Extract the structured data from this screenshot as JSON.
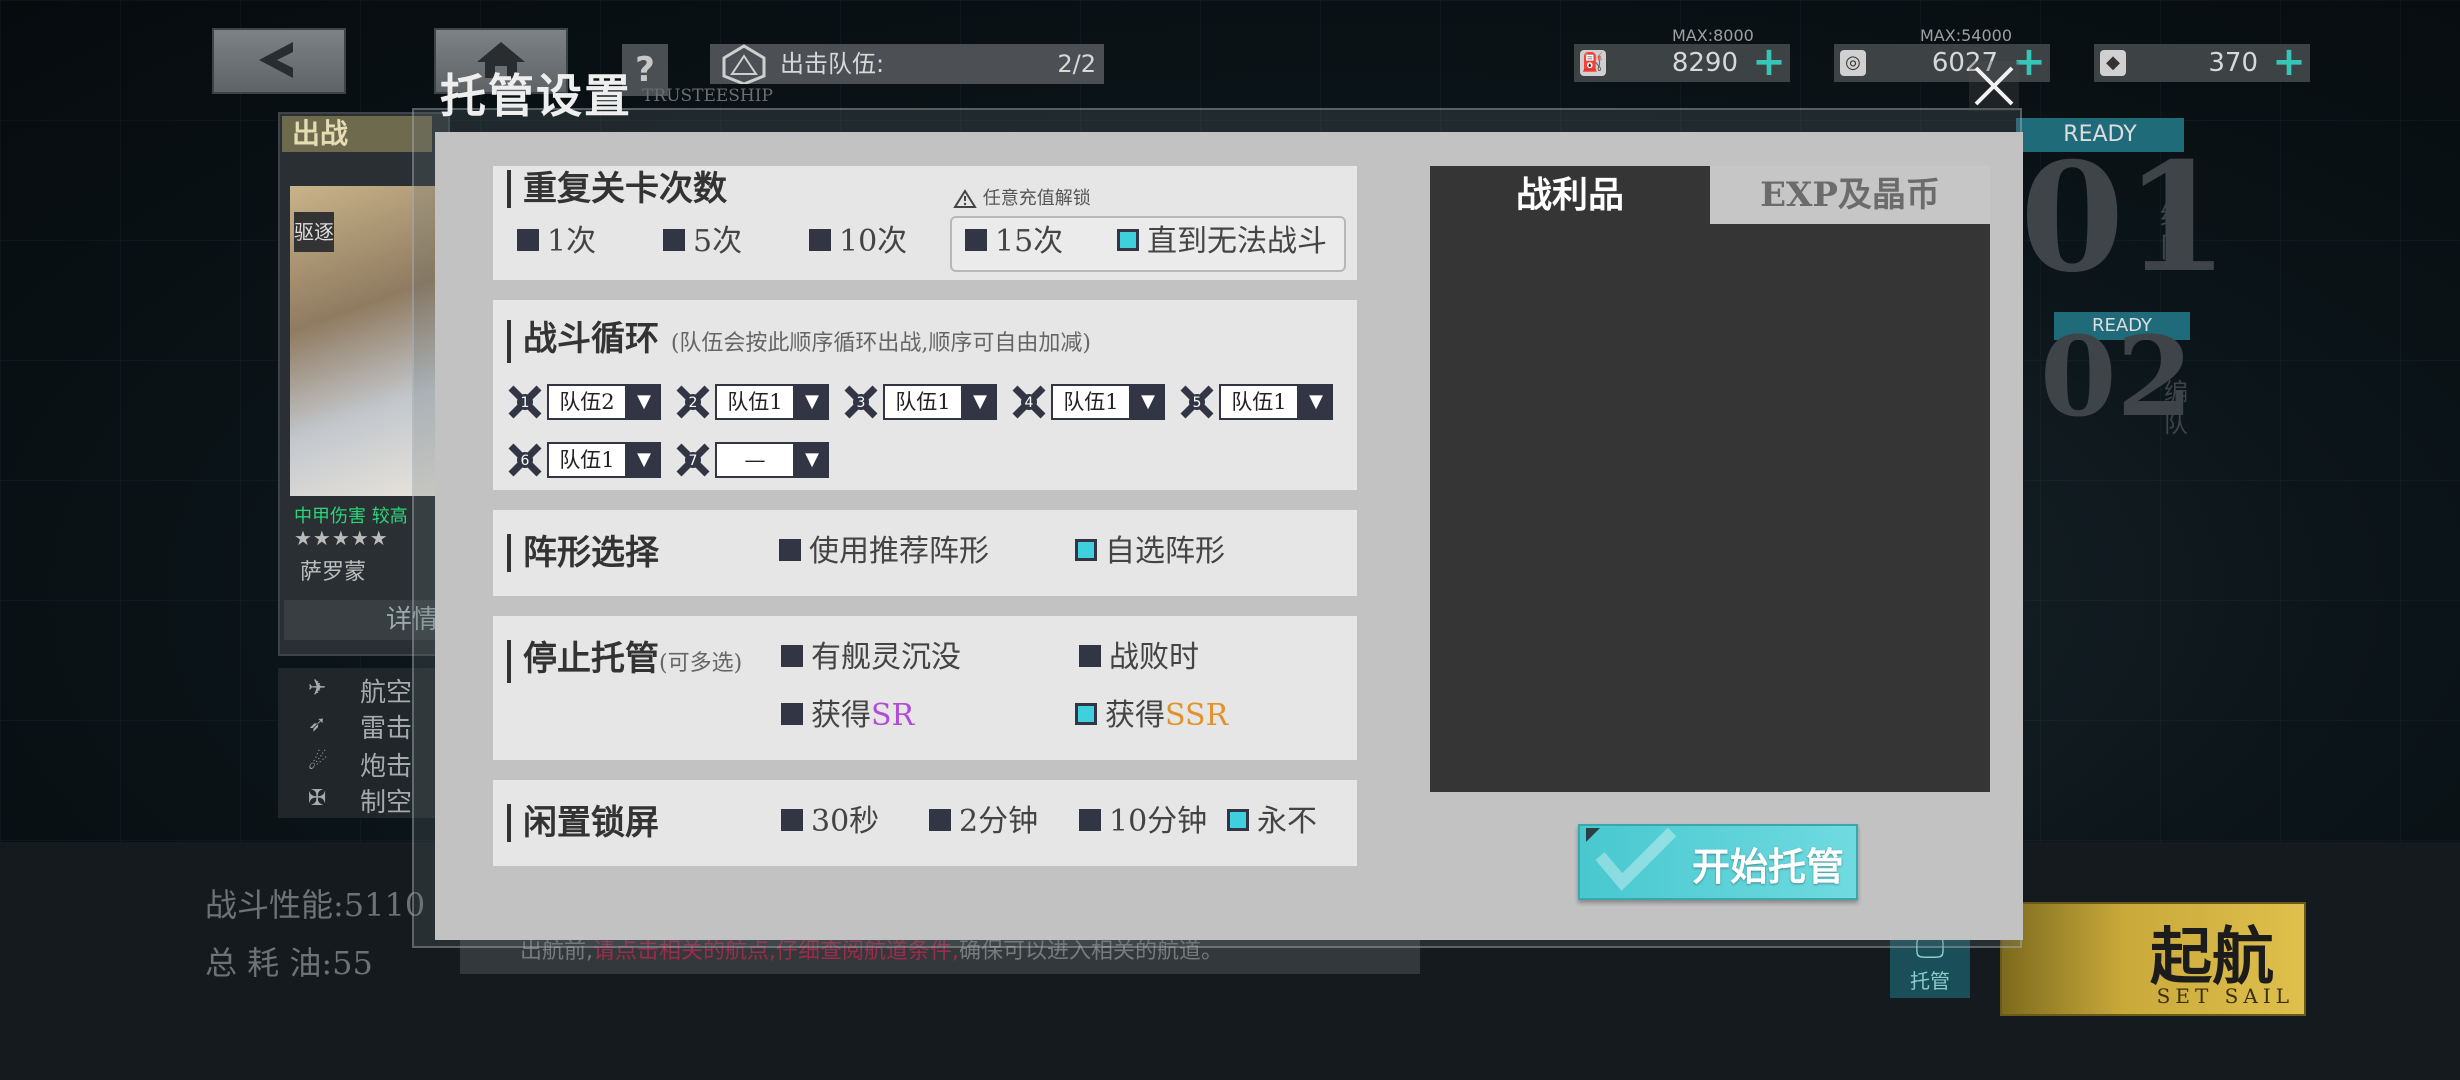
{
  "window": {
    "help": "?",
    "trustee_en": "TRUSTEESHIP"
  },
  "resources": {
    "sortie_label": "出击队伍:",
    "sortie_value": "2/2",
    "fuel": {
      "max": "MAX:8000",
      "value": "8290"
    },
    "coin": {
      "max": "MAX:54000",
      "value": "6027"
    },
    "gem": {
      "value": "370"
    }
  },
  "background": {
    "char_header": "出战",
    "char_type": "驱逐",
    "char_tag": "中甲伤害 较高",
    "char_stars": "★★★★★",
    "char_name": "萨罗蒙",
    "char_detail": "详情",
    "weapons": [
      "航空",
      "雷击",
      "炮击",
      "制空"
    ],
    "combat_power": "战斗性能:5110",
    "fuel_cost": "总 耗 油:55",
    "notice_pre": "出航前,",
    "notice_hl1": "请点击相关的航点,",
    "notice_hl2": "仔细查阅航道条件,",
    "notice_post": "确保可以进入相关的航道。",
    "team1_ready": "READY",
    "team1_num": "01",
    "team2_ready": "READY",
    "team2_num": "02",
    "team_side": "编队",
    "trust_btn": "托管",
    "set_sail_cn": "起航",
    "set_sail_en": "SET SAIL"
  },
  "dialog": {
    "title": "托管设置",
    "repeat": {
      "title": "重复关卡次数",
      "lock_note": "任意充值解锁",
      "options": [
        {
          "label": "1次",
          "checked": false
        },
        {
          "label": "5次",
          "checked": false
        },
        {
          "label": "10次",
          "checked": false
        },
        {
          "label": "15次",
          "checked": false
        },
        {
          "label": "直到无法战斗",
          "checked": true
        }
      ]
    },
    "cycle": {
      "title": "战斗循环",
      "note": "(队伍会按此顺序循环出战,顺序可自由加减)",
      "slots": [
        {
          "order": "1",
          "team": "队伍2"
        },
        {
          "order": "2",
          "team": "队伍1"
        },
        {
          "order": "3",
          "team": "队伍1"
        },
        {
          "order": "4",
          "team": "队伍1"
        },
        {
          "order": "5",
          "team": "队伍1"
        },
        {
          "order": "6",
          "team": "队伍1"
        },
        {
          "order": "7",
          "team": "—"
        }
      ]
    },
    "formation": {
      "title": "阵形选择",
      "options": [
        {
          "label": "使用推荐阵形",
          "checked": false
        },
        {
          "label": "自选阵形",
          "checked": true
        }
      ]
    },
    "stop": {
      "title": "停止托管",
      "note": "(可多选)",
      "options": [
        {
          "label": "有舰灵沉没",
          "checked": false
        },
        {
          "label": "战败时",
          "checked": false
        },
        {
          "label_pre": "获得",
          "label_hl": "SR",
          "checked": false
        },
        {
          "label_pre": "获得",
          "label_hl": "SSR",
          "checked": true
        }
      ]
    },
    "idle": {
      "title": "闲置锁屏",
      "options": [
        {
          "label": "30秒",
          "checked": false
        },
        {
          "label": "2分钟",
          "checked": false
        },
        {
          "label": "10分钟",
          "checked": false
        },
        {
          "label": "永不",
          "checked": true
        }
      ]
    },
    "tabs": [
      {
        "label": "战利品",
        "active": true
      },
      {
        "label": "EXP及晶币",
        "active": false
      }
    ],
    "start_button": "开始托管"
  },
  "colors": {
    "accent": "#3fd0dd",
    "checkbox_off": "#323544",
    "sr": "#b04cd8",
    "ssr": "#e2922a"
  }
}
